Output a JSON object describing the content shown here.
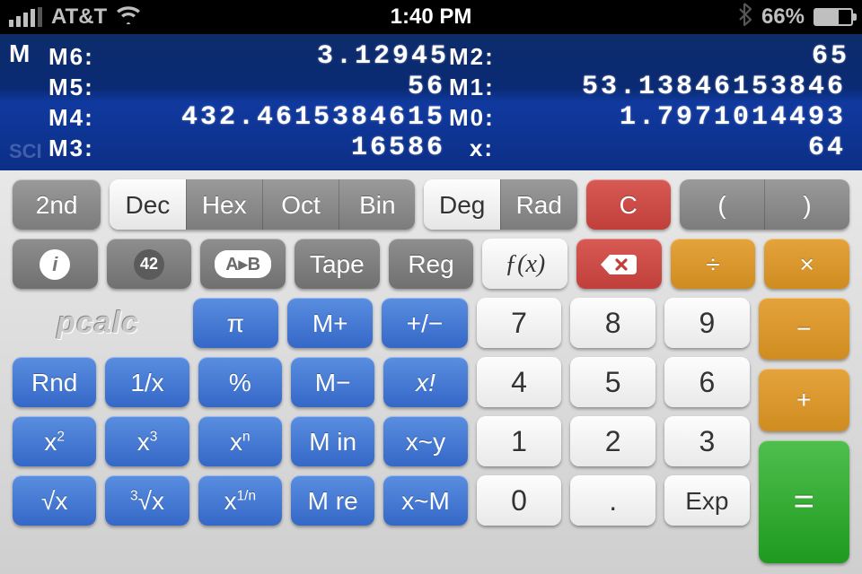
{
  "status_bar": {
    "carrier": "AT&T",
    "time": "1:40 PM",
    "battery_pct": "66%"
  },
  "display": {
    "m_indicator": "M",
    "sci_indicator": "SCI",
    "registers_left": [
      {
        "label": "M6:",
        "value": "3.12945"
      },
      {
        "label": "M5:",
        "value": "56"
      },
      {
        "label": "M4:",
        "value": "432.4615384615"
      },
      {
        "label": "M3:",
        "value": "16586"
      }
    ],
    "registers_right": [
      {
        "label": "M2:",
        "value": "65"
      },
      {
        "label": "M1:",
        "value": "53.13846153846"
      },
      {
        "label": "M0:",
        "value": "1.7971014493"
      },
      {
        "label": "x:",
        "value": "64"
      }
    ]
  },
  "row1": {
    "second": "2nd",
    "base_seg": [
      "Dec",
      "Hex",
      "Oct",
      "Bin"
    ],
    "angle_seg": [
      "Deg",
      "Rad"
    ],
    "clear": "C",
    "paren_open": "(",
    "paren_close": ")"
  },
  "row2": {
    "info": "i",
    "fortytwo": "42",
    "convert": "A▸B",
    "tape": "Tape",
    "reg": "Reg",
    "fx": "ƒ(x)",
    "divide": "÷",
    "multiply": "×"
  },
  "brand": "pcalc",
  "func": {
    "pi": "π",
    "mplus": "M+",
    "plusminus": "+/−",
    "rnd": "Rnd",
    "inv": "1/x",
    "pct": "%",
    "mminus": "M−",
    "fact": "x!",
    "x2": "x",
    "x2_sup": "2",
    "x3": "x",
    "x3_sup": "3",
    "xn": "x",
    "xn_sup": "n",
    "min": "M in",
    "xswapy": "x~y",
    "sqrt": "√x",
    "cbrt_pre": "3",
    "cbrt": "√x",
    "xroot": "x",
    "xroot_sup": "1/n",
    "mre": "M re",
    "xswapm": "x~M"
  },
  "digits": {
    "7": "7",
    "8": "8",
    "9": "9",
    "4": "4",
    "5": "5",
    "6": "6",
    "1": "1",
    "2": "2",
    "3": "3",
    "0": "0",
    "dot": ".",
    "exp": "Exp"
  },
  "ops": {
    "minus": "−",
    "plus": "+",
    "equals": "="
  }
}
